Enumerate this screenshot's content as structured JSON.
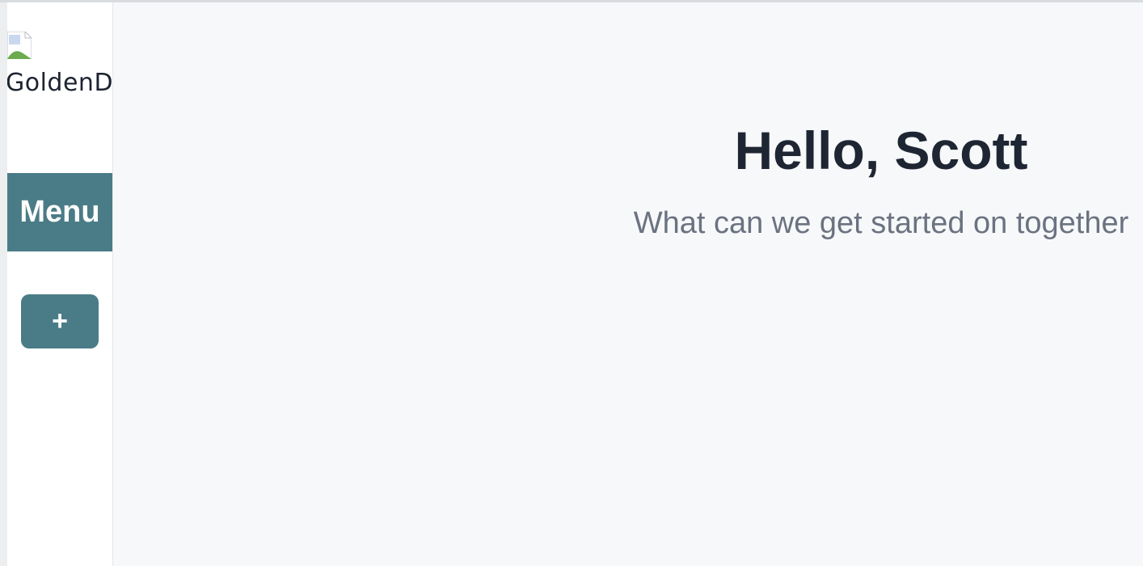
{
  "sidebar": {
    "logo_alt": "GoldenD",
    "menu_label": "Menu",
    "add_label": "+"
  },
  "main": {
    "greeting": "Hello, Scott",
    "subtitle": "What can we get started on together"
  },
  "colors": {
    "accent": "#4a7c87",
    "heading": "#1e2633",
    "muted": "#6b7280",
    "background": "#f7f8fa"
  }
}
